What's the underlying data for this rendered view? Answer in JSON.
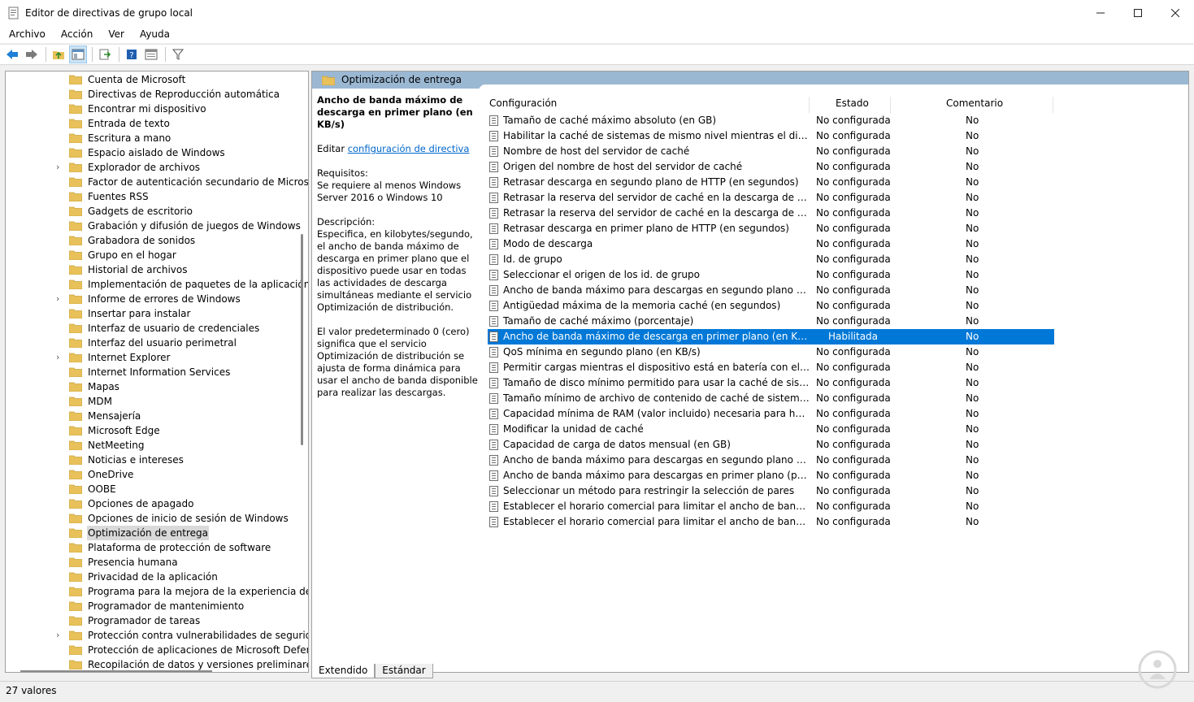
{
  "window": {
    "title": "Editor de directivas de grupo local",
    "controls": [
      "minimize-icon",
      "maximize-icon",
      "close-icon"
    ]
  },
  "menu": [
    "Archivo",
    "Acción",
    "Ver",
    "Ayuda"
  ],
  "toolbar": {
    "icons": [
      "back-arrow-icon",
      "forward-arrow-icon",
      "up-folder-icon",
      "show-hide-tree-icon",
      "export-list-icon",
      "help-icon",
      "properties-icon",
      "filter-icon"
    ]
  },
  "tree": {
    "items": [
      {
        "label": "Cuenta de Microsoft",
        "expandable": false
      },
      {
        "label": "Directivas de Reproducción automática",
        "expandable": false
      },
      {
        "label": "Encontrar mi dispositivo",
        "expandable": false
      },
      {
        "label": "Entrada de texto",
        "expandable": false
      },
      {
        "label": "Escritura a mano",
        "expandable": false
      },
      {
        "label": "Espacio aislado de Windows",
        "expandable": false
      },
      {
        "label": "Explorador de archivos",
        "expandable": true
      },
      {
        "label": "Factor de autenticación secundario de Microsoft",
        "expandable": false
      },
      {
        "label": "Fuentes RSS",
        "expandable": false
      },
      {
        "label": "Gadgets de escritorio",
        "expandable": false
      },
      {
        "label": "Grabación y difusión de juegos de Windows",
        "expandable": false
      },
      {
        "label": "Grabadora de sonidos",
        "expandable": false
      },
      {
        "label": "Grupo en el hogar",
        "expandable": false
      },
      {
        "label": "Historial de archivos",
        "expandable": false
      },
      {
        "label": "Implementación de paquetes de la aplicación",
        "expandable": false
      },
      {
        "label": "Informe de errores de Windows",
        "expandable": true
      },
      {
        "label": "Insertar para instalar",
        "expandable": false
      },
      {
        "label": "Interfaz de usuario de credenciales",
        "expandable": false
      },
      {
        "label": "Interfaz del usuario perimetral",
        "expandable": false
      },
      {
        "label": "Internet Explorer",
        "expandable": true
      },
      {
        "label": "Internet Information Services",
        "expandable": false
      },
      {
        "label": "Mapas",
        "expandable": false
      },
      {
        "label": "MDM",
        "expandable": false
      },
      {
        "label": "Mensajería",
        "expandable": false
      },
      {
        "label": "Microsoft Edge",
        "expandable": false
      },
      {
        "label": "NetMeeting",
        "expandable": false
      },
      {
        "label": "Noticias e intereses",
        "expandable": false
      },
      {
        "label": "OneDrive",
        "expandable": false
      },
      {
        "label": "OOBE",
        "expandable": false
      },
      {
        "label": "Opciones de apagado",
        "expandable": false
      },
      {
        "label": "Opciones de inicio de sesión de Windows",
        "expandable": false
      },
      {
        "label": "Optimización de entrega",
        "expandable": false,
        "selected": true
      },
      {
        "label": "Plataforma de protección de software",
        "expandable": false
      },
      {
        "label": "Presencia humana",
        "expandable": false
      },
      {
        "label": "Privacidad de la aplicación",
        "expandable": false
      },
      {
        "label": "Programa para la mejora de la experiencia del us",
        "expandable": false
      },
      {
        "label": "Programador de mantenimiento",
        "expandable": false
      },
      {
        "label": "Programador de tareas",
        "expandable": false
      },
      {
        "label": "Protección contra vulnerabilidades de seguridad",
        "expandable": true
      },
      {
        "label": "Protección de aplicaciones de Microsoft Defend",
        "expandable": false
      },
      {
        "label": "Recopilación de datos y versiones preliminares",
        "expandable": false
      }
    ]
  },
  "panel": {
    "header": "Optimización de entrega",
    "extended": {
      "title": "Ancho de banda máximo de descarga en primer plano (en KB/s)",
      "edit_prefix": "Editar ",
      "edit_link": "configuración de directiva",
      "requirements_label": "Requisitos:",
      "requirements_text": "Se requiere al menos Windows Server 2016 o Windows 10",
      "description_label": "Descripción:",
      "description_text": "Especifica, en kilobytes/segundo, el ancho de banda máximo de descarga en primer plano que el dispositivo puede usar en todas las actividades de descarga simultáneas mediante el servicio Optimización de distribución.",
      "default_text": "El valor predeterminado 0 (cero) significa que el servicio Optimización de distribución se ajusta de forma dinámica para usar el ancho de banda disponible para realizar las descargas."
    },
    "columns": {
      "config": "Configuración",
      "state": "Estado",
      "comment": "Comentario"
    },
    "rows": [
      {
        "config": "Tamaño de caché máximo absoluto (en GB)",
        "state": "No configurada",
        "comment": "No"
      },
      {
        "config": "Habilitar la caché de sistemas de mismo nivel mientras el dispositivo ...",
        "state": "No configurada",
        "comment": "No"
      },
      {
        "config": "Nombre de host del servidor de caché",
        "state": "No configurada",
        "comment": "No"
      },
      {
        "config": "Origen del nombre de host del servidor de caché",
        "state": "No configurada",
        "comment": "No"
      },
      {
        "config": "Retrasar descarga en segundo plano de HTTP (en segundos)",
        "state": "No configurada",
        "comment": "No"
      },
      {
        "config": "Retrasar la reserva del servidor de caché en la descarga de segundo pl...",
        "state": "No configurada",
        "comment": "No"
      },
      {
        "config": "Retrasar la reserva del servidor de caché en la descarga de primer plan...",
        "state": "No configurada",
        "comment": "No"
      },
      {
        "config": "Retrasar descarga en primer plano de HTTP (en segundos)",
        "state": "No configurada",
        "comment": "No"
      },
      {
        "config": "Modo de descarga",
        "state": "No configurada",
        "comment": "No"
      },
      {
        "config": "Id. de grupo",
        "state": "No configurada",
        "comment": "No"
      },
      {
        "config": "Seleccionar el origen de los id. de grupo",
        "state": "No configurada",
        "comment": "No"
      },
      {
        "config": "Ancho de banda máximo para descargas en segundo plano (en KB/s)",
        "state": "No configurada",
        "comment": "No"
      },
      {
        "config": "Antigüedad máxima de la memoria caché (en segundos)",
        "state": "No configurada",
        "comment": "No"
      },
      {
        "config": "Tamaño de caché máximo (porcentaje)",
        "state": "No configurada",
        "comment": "No"
      },
      {
        "config": "Ancho de banda máximo de descarga en primer plano (en KB/s)",
        "state": "Habilitada",
        "comment": "No",
        "selected": true
      },
      {
        "config": "QoS mínima en segundo plano (en KB/s)",
        "state": "No configurada",
        "comment": "No"
      },
      {
        "config": "Permitir cargas mientras el dispositivo está en batería con el nivel de ...",
        "state": "No configurada",
        "comment": "No"
      },
      {
        "config": "Tamaño de disco mínimo permitido para usar la caché de sistema de ...",
        "state": "No configurada",
        "comment": "No"
      },
      {
        "config": "Tamaño mínimo de archivo de contenido de caché de sistemas de mi...",
        "state": "No configurada",
        "comment": "No"
      },
      {
        "config": "Capacidad mínima de RAM (valor incluido) necesaria para habilitar el...",
        "state": "No configurada",
        "comment": "No"
      },
      {
        "config": "Modificar la unidad de caché",
        "state": "No configurada",
        "comment": "No"
      },
      {
        "config": "Capacidad de carga de datos mensual (en GB)",
        "state": "No configurada",
        "comment": "No"
      },
      {
        "config": "Ancho de banda máximo para descargas en segundo plano (porcent...",
        "state": "No configurada",
        "comment": "No"
      },
      {
        "config": "Ancho de banda máximo para descargas en primer plano (porcentaje)",
        "state": "No configurada",
        "comment": "No"
      },
      {
        "config": "Seleccionar un método para restringir la selección de pares",
        "state": "No configurada",
        "comment": "No"
      },
      {
        "config": "Establecer el horario comercial para limitar el ancho de banda de des...",
        "state": "No configurada",
        "comment": "No"
      },
      {
        "config": "Establecer el horario comercial para limitar el ancho de banda de des...",
        "state": "No configurada",
        "comment": "No"
      }
    ]
  },
  "tabs": [
    "Extendido",
    "Estándar"
  ],
  "status": "27 valores",
  "colors": {
    "selection": "#0078d7",
    "header_band": "#9bb8d3",
    "folder": "#e8c15a",
    "link": "#0066cc"
  }
}
